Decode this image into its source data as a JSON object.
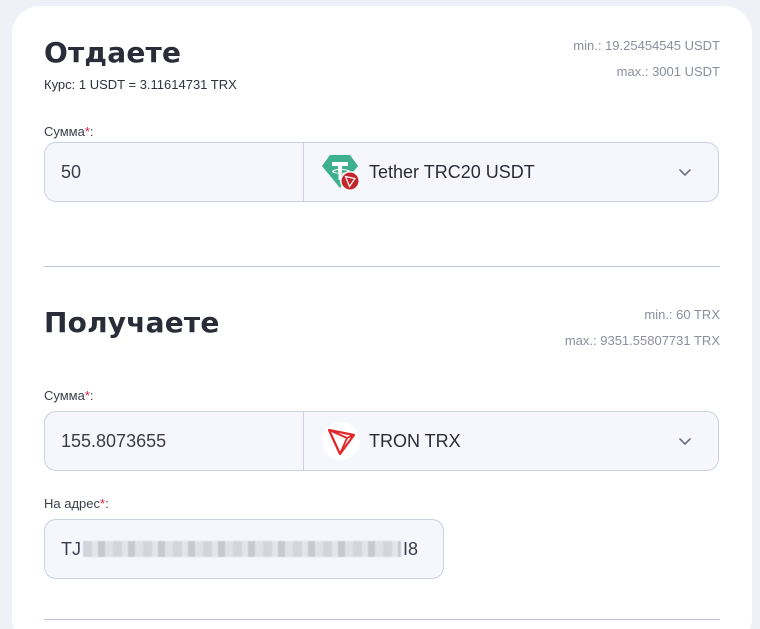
{
  "give": {
    "title": "Отдаете",
    "rate": "Курс: 1 USDT = 3.11614731 TRX",
    "min": "min.: 19.25454545 USDT",
    "max": "max.: 3001 USDT",
    "amount_label": "Сумма",
    "required_mark": "*",
    "label_suffix": ":",
    "amount_value": "50",
    "currency": "Tether TRC20 USDT",
    "currency_icon": "tether-trc20-icon"
  },
  "receive": {
    "title": "Получаете",
    "min": "min.: 60 TRX",
    "max": "max.: 9351.55807731 TRX",
    "amount_label": "Сумма",
    "required_mark": "*",
    "label_suffix": ":",
    "amount_value": "155.8073655",
    "currency": "TRON TRX",
    "currency_icon": "tron-icon",
    "address_label": "На адрес",
    "address_prefix": "TJ",
    "address_suffix": "I8"
  },
  "colors": {
    "required": "#d6263a",
    "tether": "#26a17b",
    "tron": "#e0282b"
  }
}
